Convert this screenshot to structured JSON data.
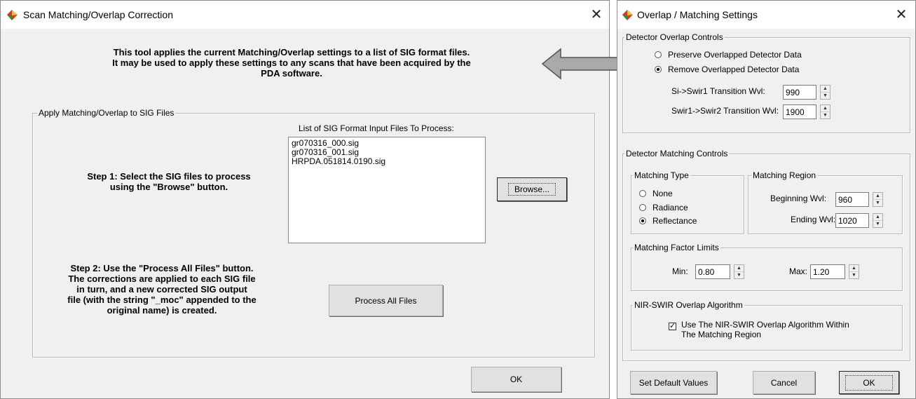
{
  "scan_window": {
    "title": "Scan Matching/Overlap Correction",
    "close_glyph": "✕",
    "intro_line1": "This tool applies the current Matching/Overlap settings to a list of SIG format files.",
    "intro_line2": "It may be used to apply these settings to any scans that have been acquired by the",
    "intro_line3": "PDA software.",
    "group_label": "Apply Matching/Overlap to SIG Files",
    "list_label": "List of SIG Format Input Files To Process:",
    "files": [
      "gr070316_000.sig",
      "gr070316_001.sig",
      "HRPDA.051814.0190.sig"
    ],
    "step1_line1": "Step 1: Select the SIG files to process",
    "step1_line2": "using the \"Browse\" button.",
    "browse_label": "Browse...",
    "step2_line1": "Step 2: Use the \"Process All Files\" button.",
    "step2_line2": "The corrections are applied to each SIG file",
    "step2_line3": "in turn, and a new corrected SIG output",
    "step2_line4": "file (with the string \"_moc\" appended to the",
    "step2_line5": "original name) is created.",
    "process_label": "Process All Files",
    "ok_label": "OK"
  },
  "settings_window": {
    "title": "Overlap / Matching Settings",
    "close_glyph": "✕",
    "overlap_group": "Detector Overlap Controls",
    "preserve_label": "Preserve Overlapped Detector Data",
    "remove_label": "Remove Overlapped Detector Data",
    "si_swir1_label": "Si->Swir1 Transition Wvl:",
    "si_swir1_value": "990",
    "swir1_swir2_label": "Swir1->Swir2 Transition Wvl:",
    "swir1_swir2_value": "1900",
    "matching_group": "Detector Matching Controls",
    "matching_type_group": "Matching Type",
    "type_none": "None",
    "type_radiance": "Radiance",
    "type_reflectance": "Reflectance",
    "matching_region_group": "Matching Region",
    "beginning_label": "Beginning Wvl:",
    "beginning_value": "960",
    "ending_label": "Ending Wvl:",
    "ending_value": "1020",
    "factor_group": "Matching Factor Limits",
    "min_label": "Min:",
    "min_value": "0.80",
    "max_label": "Max:",
    "max_value": "1.20",
    "nir_group": "NIR-SWIR Overlap Algorithm",
    "nir_check_line1": "Use The NIR-SWIR Overlap Algorithm Within",
    "nir_check_line2": "The Matching Region",
    "set_default_label": "Set Default Values",
    "cancel_label": "Cancel",
    "ok_label": "OK"
  },
  "colors": {
    "arrow_fill": "#a9a9a9",
    "arrow_stroke": "#555555"
  }
}
